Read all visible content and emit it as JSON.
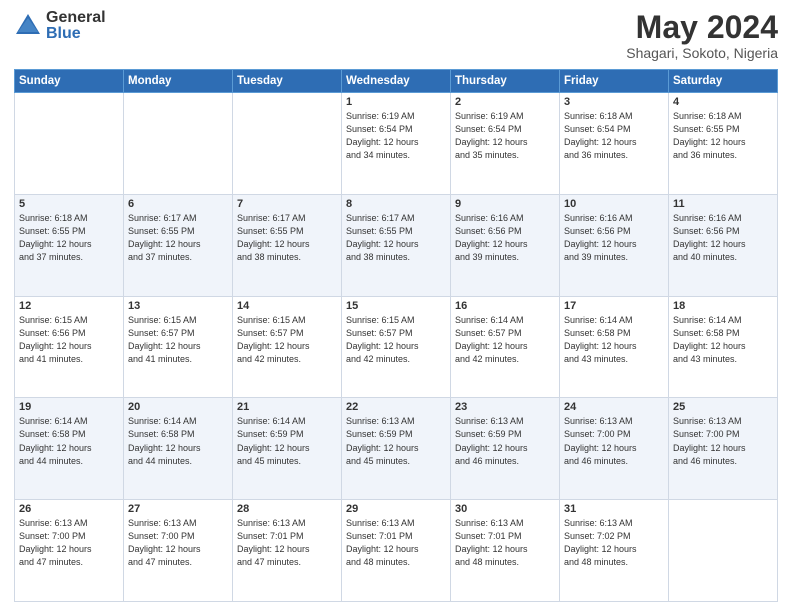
{
  "header": {
    "logo_general": "General",
    "logo_blue": "Blue",
    "main_title": "May 2024",
    "subtitle": "Shagari, Sokoto, Nigeria"
  },
  "days_of_week": [
    "Sunday",
    "Monday",
    "Tuesday",
    "Wednesday",
    "Thursday",
    "Friday",
    "Saturday"
  ],
  "weeks": [
    [
      {
        "day": "",
        "info": ""
      },
      {
        "day": "",
        "info": ""
      },
      {
        "day": "",
        "info": ""
      },
      {
        "day": "1",
        "info": "Sunrise: 6:19 AM\nSunset: 6:54 PM\nDaylight: 12 hours\nand 34 minutes."
      },
      {
        "day": "2",
        "info": "Sunrise: 6:19 AM\nSunset: 6:54 PM\nDaylight: 12 hours\nand 35 minutes."
      },
      {
        "day": "3",
        "info": "Sunrise: 6:18 AM\nSunset: 6:54 PM\nDaylight: 12 hours\nand 36 minutes."
      },
      {
        "day": "4",
        "info": "Sunrise: 6:18 AM\nSunset: 6:55 PM\nDaylight: 12 hours\nand 36 minutes."
      }
    ],
    [
      {
        "day": "5",
        "info": "Sunrise: 6:18 AM\nSunset: 6:55 PM\nDaylight: 12 hours\nand 37 minutes."
      },
      {
        "day": "6",
        "info": "Sunrise: 6:17 AM\nSunset: 6:55 PM\nDaylight: 12 hours\nand 37 minutes."
      },
      {
        "day": "7",
        "info": "Sunrise: 6:17 AM\nSunset: 6:55 PM\nDaylight: 12 hours\nand 38 minutes."
      },
      {
        "day": "8",
        "info": "Sunrise: 6:17 AM\nSunset: 6:55 PM\nDaylight: 12 hours\nand 38 minutes."
      },
      {
        "day": "9",
        "info": "Sunrise: 6:16 AM\nSunset: 6:56 PM\nDaylight: 12 hours\nand 39 minutes."
      },
      {
        "day": "10",
        "info": "Sunrise: 6:16 AM\nSunset: 6:56 PM\nDaylight: 12 hours\nand 39 minutes."
      },
      {
        "day": "11",
        "info": "Sunrise: 6:16 AM\nSunset: 6:56 PM\nDaylight: 12 hours\nand 40 minutes."
      }
    ],
    [
      {
        "day": "12",
        "info": "Sunrise: 6:15 AM\nSunset: 6:56 PM\nDaylight: 12 hours\nand 41 minutes."
      },
      {
        "day": "13",
        "info": "Sunrise: 6:15 AM\nSunset: 6:57 PM\nDaylight: 12 hours\nand 41 minutes."
      },
      {
        "day": "14",
        "info": "Sunrise: 6:15 AM\nSunset: 6:57 PM\nDaylight: 12 hours\nand 42 minutes."
      },
      {
        "day": "15",
        "info": "Sunrise: 6:15 AM\nSunset: 6:57 PM\nDaylight: 12 hours\nand 42 minutes."
      },
      {
        "day": "16",
        "info": "Sunrise: 6:14 AM\nSunset: 6:57 PM\nDaylight: 12 hours\nand 42 minutes."
      },
      {
        "day": "17",
        "info": "Sunrise: 6:14 AM\nSunset: 6:58 PM\nDaylight: 12 hours\nand 43 minutes."
      },
      {
        "day": "18",
        "info": "Sunrise: 6:14 AM\nSunset: 6:58 PM\nDaylight: 12 hours\nand 43 minutes."
      }
    ],
    [
      {
        "day": "19",
        "info": "Sunrise: 6:14 AM\nSunset: 6:58 PM\nDaylight: 12 hours\nand 44 minutes."
      },
      {
        "day": "20",
        "info": "Sunrise: 6:14 AM\nSunset: 6:58 PM\nDaylight: 12 hours\nand 44 minutes."
      },
      {
        "day": "21",
        "info": "Sunrise: 6:14 AM\nSunset: 6:59 PM\nDaylight: 12 hours\nand 45 minutes."
      },
      {
        "day": "22",
        "info": "Sunrise: 6:13 AM\nSunset: 6:59 PM\nDaylight: 12 hours\nand 45 minutes."
      },
      {
        "day": "23",
        "info": "Sunrise: 6:13 AM\nSunset: 6:59 PM\nDaylight: 12 hours\nand 46 minutes."
      },
      {
        "day": "24",
        "info": "Sunrise: 6:13 AM\nSunset: 7:00 PM\nDaylight: 12 hours\nand 46 minutes."
      },
      {
        "day": "25",
        "info": "Sunrise: 6:13 AM\nSunset: 7:00 PM\nDaylight: 12 hours\nand 46 minutes."
      }
    ],
    [
      {
        "day": "26",
        "info": "Sunrise: 6:13 AM\nSunset: 7:00 PM\nDaylight: 12 hours\nand 47 minutes."
      },
      {
        "day": "27",
        "info": "Sunrise: 6:13 AM\nSunset: 7:00 PM\nDaylight: 12 hours\nand 47 minutes."
      },
      {
        "day": "28",
        "info": "Sunrise: 6:13 AM\nSunset: 7:01 PM\nDaylight: 12 hours\nand 47 minutes."
      },
      {
        "day": "29",
        "info": "Sunrise: 6:13 AM\nSunset: 7:01 PM\nDaylight: 12 hours\nand 48 minutes."
      },
      {
        "day": "30",
        "info": "Sunrise: 6:13 AM\nSunset: 7:01 PM\nDaylight: 12 hours\nand 48 minutes."
      },
      {
        "day": "31",
        "info": "Sunrise: 6:13 AM\nSunset: 7:02 PM\nDaylight: 12 hours\nand 48 minutes."
      },
      {
        "day": "",
        "info": ""
      }
    ]
  ]
}
